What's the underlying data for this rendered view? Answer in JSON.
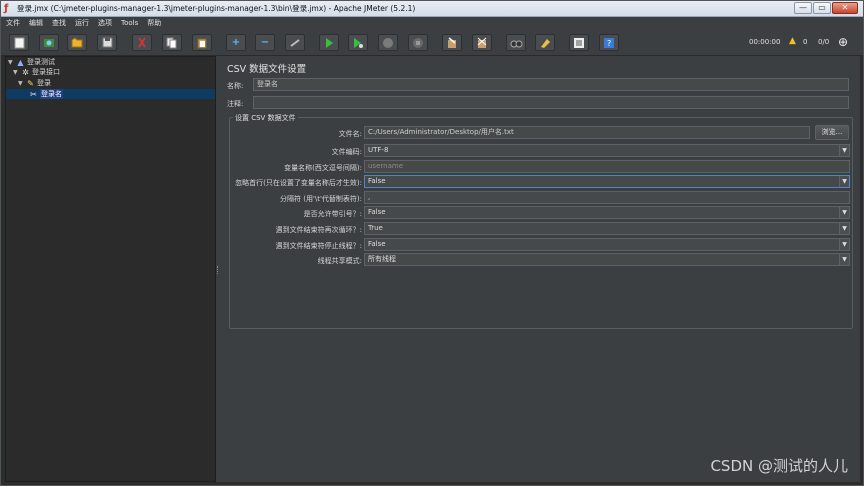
{
  "window": {
    "title": "登录.jmx (C:\\jmeter-plugins-manager-1.3\\jmeter-plugins-manager-1.3\\bin\\登录.jmx) - Apache JMeter (5.2.1)",
    "minimize": "—",
    "maximize": "▭",
    "close": "✕"
  },
  "menu": [
    "文件",
    "编辑",
    "查找",
    "运行",
    "选项",
    "Tools",
    "帮助"
  ],
  "toolbar": {
    "timer": "00:00:00",
    "warnings": "0",
    "threads": "0/0"
  },
  "tree": {
    "nodes": [
      {
        "label": "登录测试",
        "icon": "flask-icon"
      },
      {
        "label": "登录接口",
        "icon": "gear-icon"
      },
      {
        "label": "登录",
        "icon": "pen-icon"
      },
      {
        "label": "登录名",
        "icon": "scissors-icon"
      }
    ]
  },
  "panel": {
    "title": "CSV 数据文件设置",
    "name_label": "名称:",
    "name_value": "登录名",
    "comment_label": "注释:",
    "comment_value": "",
    "group_title": "设置 CSV 数据文件",
    "browse_button": "浏览...",
    "fields": [
      {
        "label": "文件名:",
        "value": "C:/Users/Administrator/Desktop/用户名.txt"
      },
      {
        "label": "文件编码:",
        "value": "UTF-8"
      },
      {
        "label": "变量名称(西文逗号间隔):",
        "value": "username"
      },
      {
        "label": "忽略首行(只在设置了变量名称后才生效):",
        "value": "False"
      },
      {
        "label": "分隔符 (用'\\t'代替制表符):",
        "value": ","
      },
      {
        "label": "是否允许带引号？:",
        "value": "False"
      },
      {
        "label": "遇到文件结束符再次循环？:",
        "value": "True"
      },
      {
        "label": "遇到文件结束符停止线程？:",
        "value": "False"
      },
      {
        "label": "线程共享模式:",
        "value": "所有线程"
      }
    ]
  },
  "watermark": "CSDN @测试的人儿",
  "colors": {
    "background": "#3c3f41",
    "tree_bg": "#2b2b2b",
    "selection": "#214283",
    "focus_border": "#4a88c7"
  }
}
